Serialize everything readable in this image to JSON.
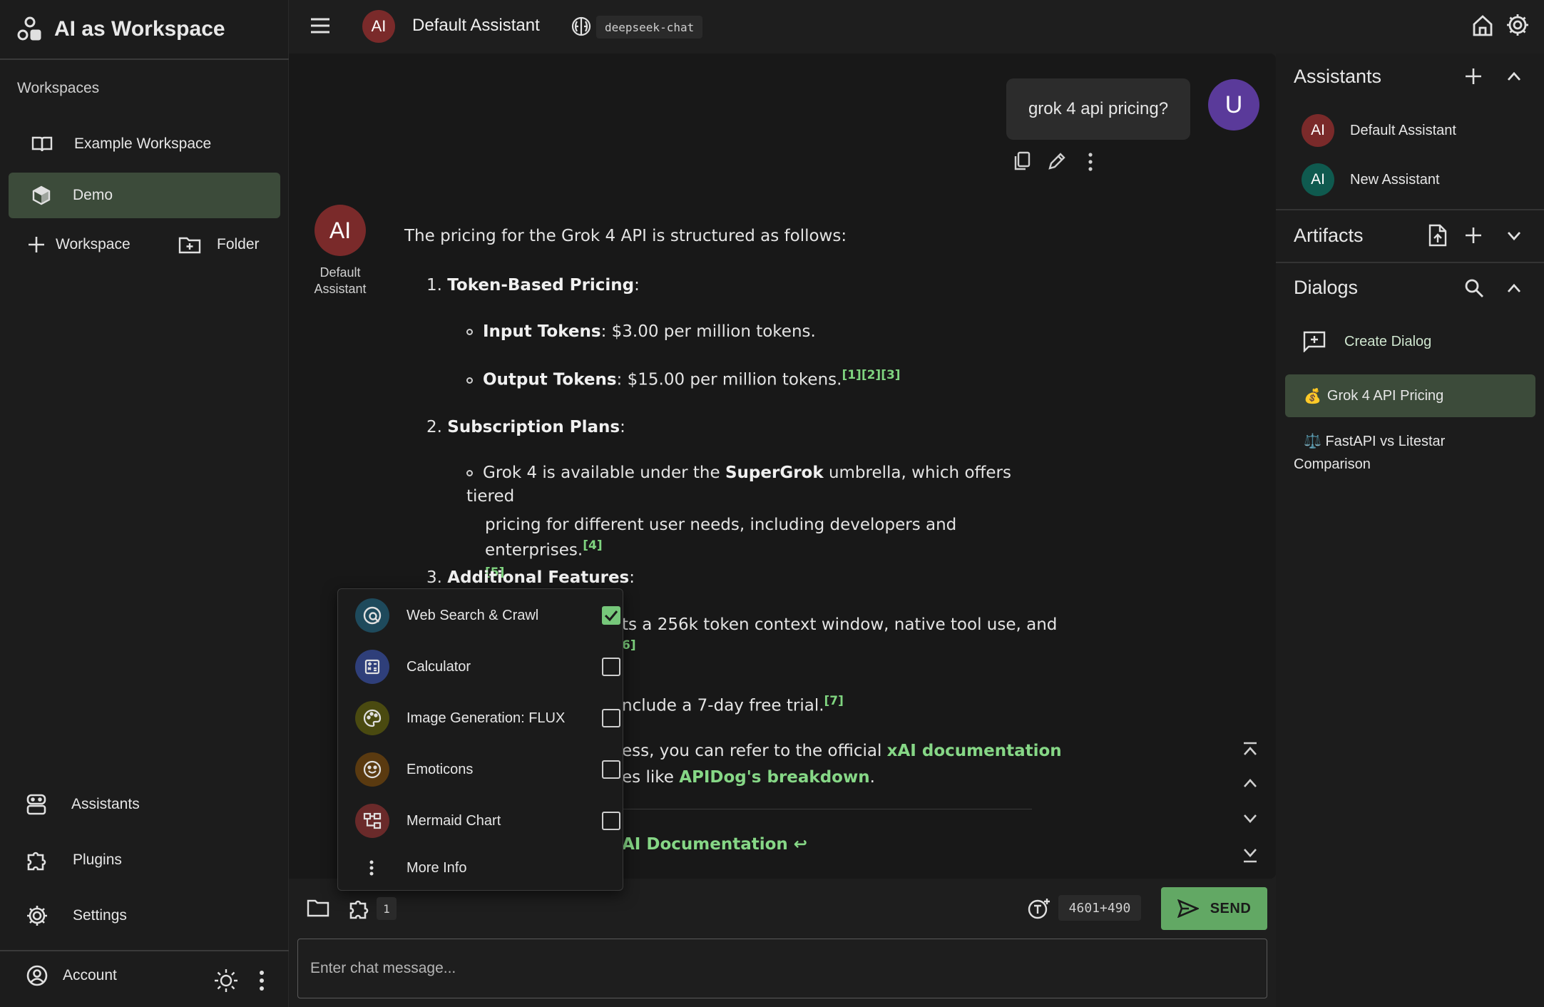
{
  "app": {
    "title": "AI as Workspace"
  },
  "sidebar": {
    "workspaces_header": "Workspaces",
    "workspaces": [
      {
        "label": "Example Workspace",
        "icon": "book-icon",
        "active": false
      },
      {
        "label": "Demo",
        "icon": "cube-icon",
        "active": true
      }
    ],
    "add_workspace_label": "Workspace",
    "add_folder_label": "Folder",
    "nav": [
      {
        "label": "Assistants",
        "icon": "robot-icon"
      },
      {
        "label": "Plugins",
        "icon": "puzzle-icon"
      },
      {
        "label": "Settings",
        "icon": "gear-icon"
      }
    ],
    "account_label": "Account"
  },
  "topbar": {
    "assistant_avatar": "AI",
    "assistant_name": "Default Assistant",
    "model": "deepseek-chat"
  },
  "chat": {
    "user_avatar": "U",
    "user_message": "grok 4 api pricing?",
    "assistant_avatar": "AI",
    "assistant_name_line1": "Default",
    "assistant_name_line2": "Assistant",
    "response": {
      "intro": "The pricing for the Grok 4 API is structured as follows:",
      "item1_num": "1.",
      "item1_title": "Token-Based Pricing",
      "input_label": "Input Tokens",
      "input_text": ": $3.00 per million tokens.",
      "output_label": "Output Tokens",
      "output_text": ": $15.00 per million tokens.",
      "output_cites": "[1][2][3]",
      "item2_num": "2.",
      "item2_title": "Subscription Plans",
      "sub_text_a": "Grok 4 is available under the ",
      "sub_bold": "SuperGrok",
      "sub_text_b": " umbrella, which offers tiered",
      "sub_text_c": "pricing for different user needs, including developers and enterprises.",
      "sub_cite_a": "[4]",
      "sub_cite_b": "[5]",
      "item3_num": "3.",
      "item3_title": "Additional Features",
      "feat_text": "ts a 256k token context window, native tool use, and",
      "feat_cite": "6]",
      "trial_text": "nclude a 7-day free trial.",
      "trial_cite": "[7]",
      "ref_text_a": "ess, you can refer to the official ",
      "ref_link_a": "xAI documentation",
      "ref_text_b": "es like ",
      "ref_link_b": "APIDog's breakdown",
      "ref_text_c": ".",
      "doc_link": "AI Documentation ↩"
    }
  },
  "plugins_popup": {
    "items": [
      {
        "label": "Web Search & Crawl",
        "icon": "web-search-icon",
        "color": "#1e4a5c",
        "checked": true
      },
      {
        "label": "Calculator",
        "icon": "calculator-icon",
        "color": "#2f3f7a",
        "checked": false
      },
      {
        "label": "Image Generation: FLUX",
        "icon": "palette-icon",
        "color": "#4a4a10",
        "checked": false
      },
      {
        "label": "Emoticons",
        "icon": "smile-icon",
        "color": "#5a3a10",
        "checked": false
      },
      {
        "label": "Mermaid Chart",
        "icon": "diagram-icon",
        "color": "#6a2a2a",
        "checked": false
      }
    ],
    "more_info": "More Info"
  },
  "input_bar": {
    "plugin_count": "1",
    "token_count": "4601+490",
    "send_label": "SEND",
    "placeholder": "Enter chat message..."
  },
  "right_panel": {
    "assistants_title": "Assistants",
    "assistants": [
      {
        "avatar": "AI",
        "label": "Default Assistant",
        "color": "#7a2a2a"
      },
      {
        "avatar": "AI",
        "label": "New Assistant",
        "color": "#0f5a4f"
      }
    ],
    "artifacts_title": "Artifacts",
    "dialogs_title": "Dialogs",
    "create_dialog": "Create Dialog",
    "dialogs": [
      {
        "emoji": "💰",
        "label": "Grok 4 API Pricing",
        "active": true
      },
      {
        "emoji": "⚖️",
        "label_line1": "FastAPI vs Litestar",
        "label_line2": "Comparison",
        "active": false
      }
    ]
  },
  "colors": {
    "accent_green": "#62a864",
    "active_bg": "#3c4b3a",
    "link_green": "#86d786",
    "assistant_avatar_bg": "#7a2a2a",
    "user_avatar_bg": "#5a3a9a"
  }
}
